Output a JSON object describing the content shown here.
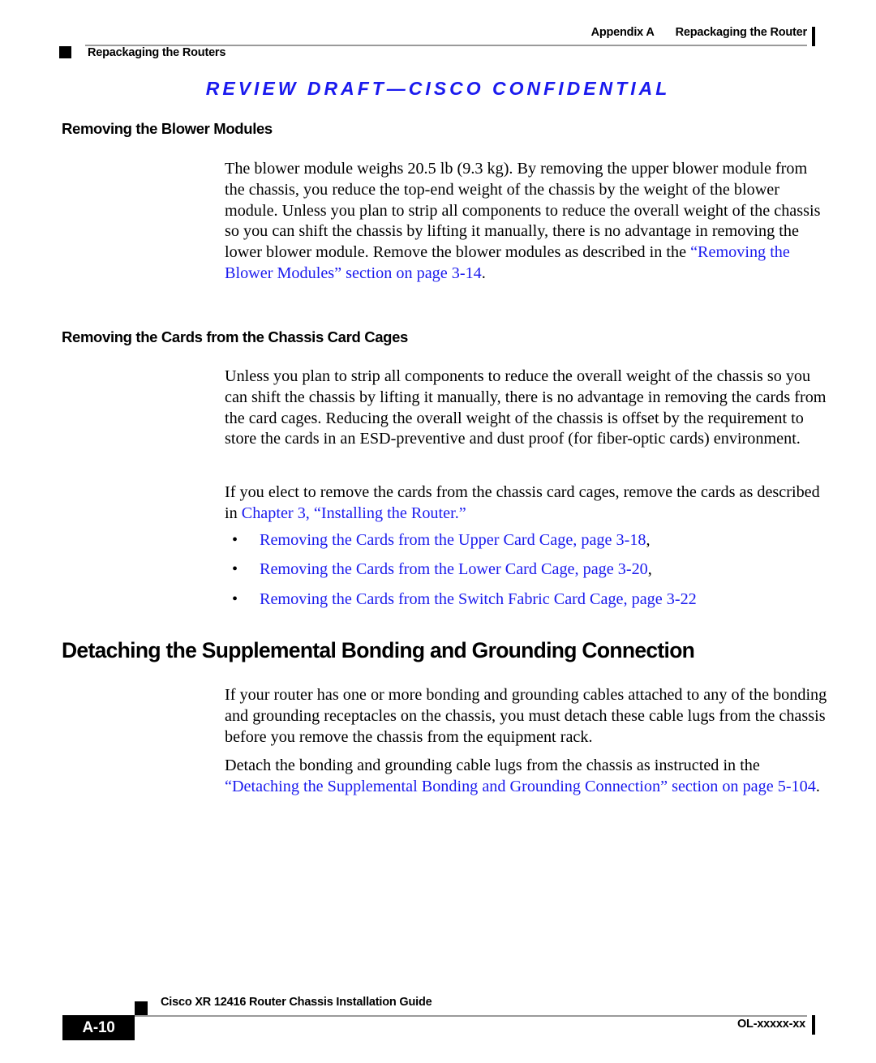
{
  "header": {
    "appendix_label": "Appendix A",
    "running_title": "Repackaging the Router",
    "section_marker_label": "Repackaging the Routers"
  },
  "draft_banner": {
    "text": "REVIEW DRAFT—CISCO CONFIDENTIAL",
    "color": "#1a1aee"
  },
  "content": {
    "heading_blower": "Removing the Blower Modules",
    "para_blower_1": "The blower module weighs 20.5 lb (9.3 kg). By removing the upper blower module from the chassis, you reduce the top-end weight of the chassis by the weight of the blower module. Unless you plan to strip all components to reduce the overall weight of the chassis so you can shift the chassis by lifting it manually, there is no advantage in removing the lower blower module. Remove the blower modules as described in the ",
    "para_blower_1_link": "“Removing the Blower Modules” section on page 3-14",
    "para_blower_1_tail": ".",
    "heading_cards": "Removing the Cards from the Chassis Card Cages",
    "para_cards_1": "Unless you plan to strip all components to reduce the overall weight of the chassis so you can shift the chassis by lifting it manually, there is no advantage in removing the cards from the card cages. Reducing the overall weight of the chassis is offset by the requirement to store the cards in an ESD-preventive and dust proof (for fiber-optic cards) environment.",
    "para_cards_2": "If you elect to remove the cards from the chassis card cages, remove the cards as described in ",
    "para_cards_2_link": "Chapter 3, “Installing the Router.”",
    "bullets": [
      {
        "bullet": "•",
        "link": "Removing the Cards from the Upper Card Cage, page 3-18",
        "tail": ","
      },
      {
        "bullet": "•",
        "link": "Removing the Cards from the Lower Card Cage, page 3-20",
        "tail": ","
      },
      {
        "bullet": "•",
        "link": "Removing the Cards from the Switch Fabric Card Cage, page 3-22",
        "tail": ""
      }
    ],
    "heading_detaching": "Detaching the Supplemental Bonding and Grounding Connection",
    "para_detach_1": "If your router has one or more bonding and grounding cables attached to any of the bonding and grounding receptacles on the chassis, you must detach these cable lugs from the chassis before you remove the chassis from the equipment rack.",
    "para_detach_2": "Detach the bonding and grounding cable lugs from the chassis as instructed in the ",
    "para_detach_2_link": "“Detaching the Supplemental Bonding and Grounding Connection” section on page 5-104",
    "para_detach_2_tail": "."
  },
  "footer": {
    "doc_title": "Cisco XR 12416 Router Chassis Installation Guide",
    "page_number": "A-10",
    "doc_id": "OL-xxxxx-xx"
  }
}
